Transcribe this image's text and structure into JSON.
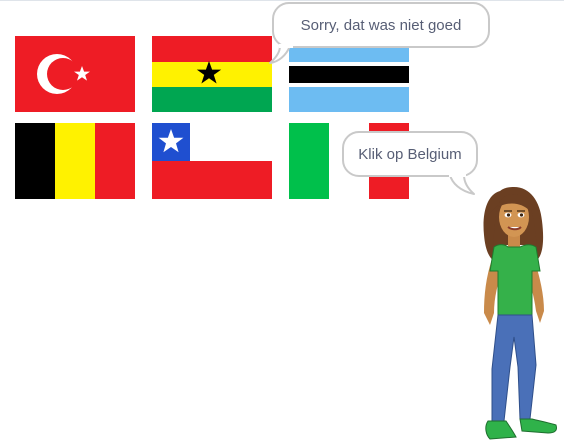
{
  "stage": {
    "flags": [
      {
        "country": "Turkey"
      },
      {
        "country": "Ghana"
      },
      {
        "country": "Botswana"
      },
      {
        "country": "Belgium"
      },
      {
        "country": "Chile"
      },
      {
        "country": "Italy"
      }
    ],
    "speech_bubbles": {
      "wrong_answer": "Sorry, dat was niet goed",
      "instruction": "Klik op Belgium"
    },
    "colors": {
      "stage_background": "#ffffff",
      "bubble_border": "#c9c9c9",
      "bubble_text": "#575e75"
    }
  }
}
